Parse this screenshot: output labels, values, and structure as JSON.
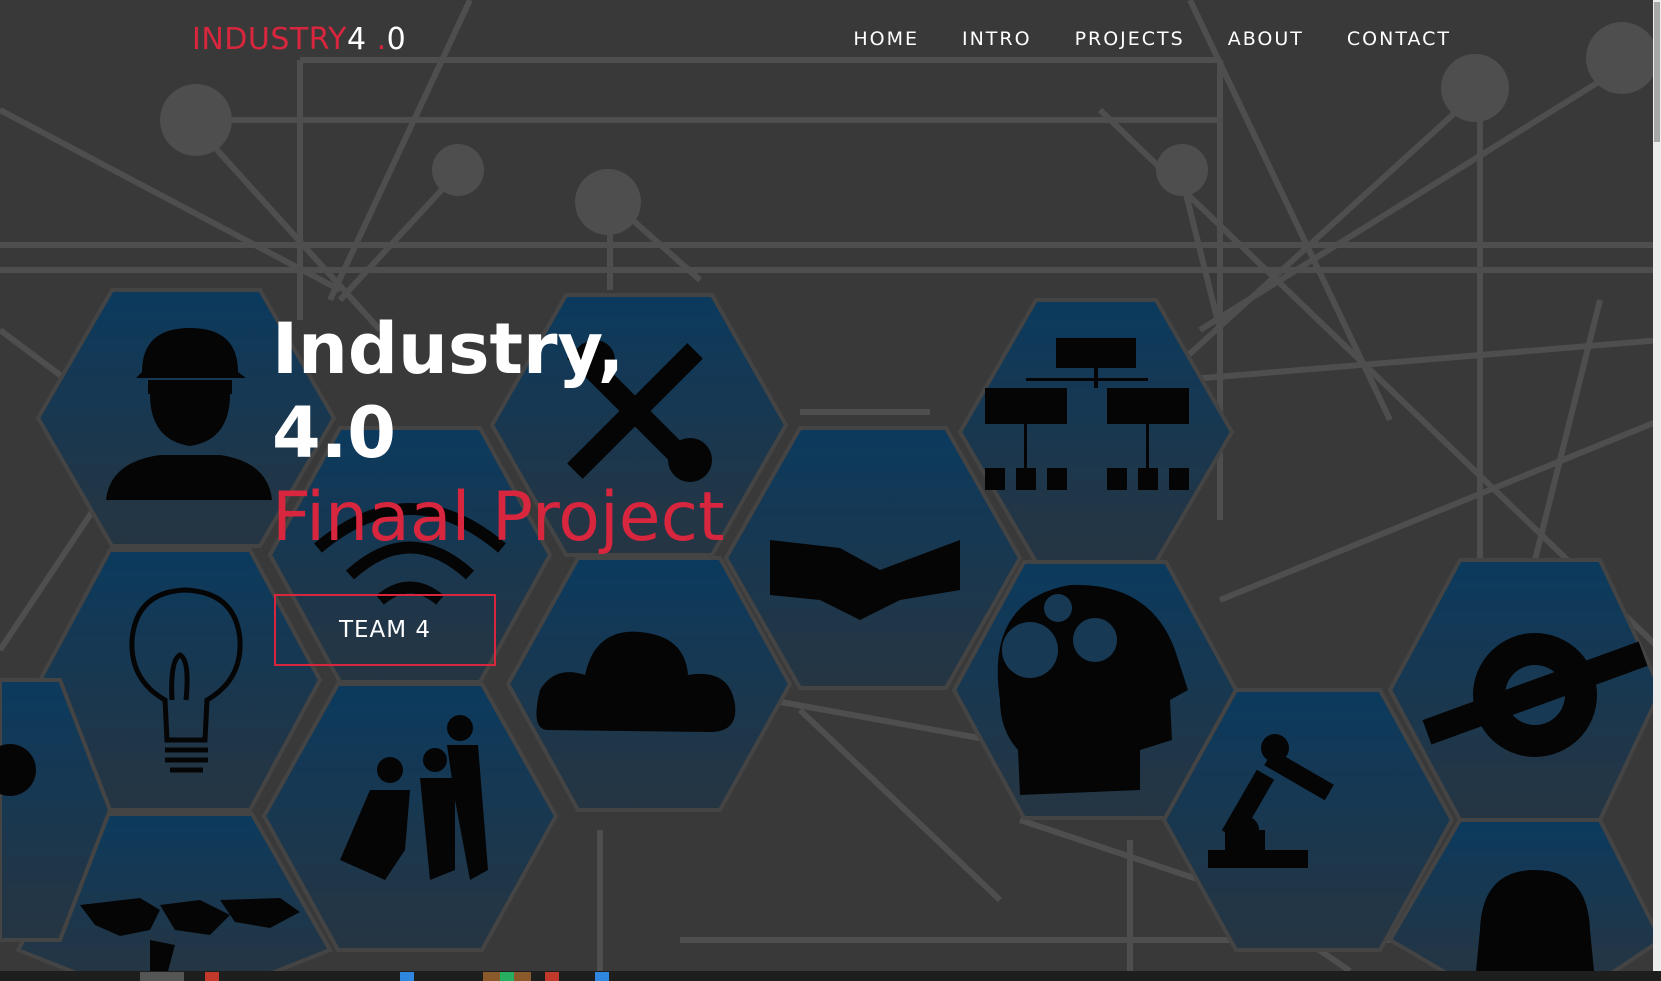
{
  "logo": {
    "part1": "INDUSTRY",
    "part2": "4",
    "dot": " .",
    "part3": "0"
  },
  "nav": {
    "items": [
      {
        "label": "HOME"
      },
      {
        "label": "INTRO"
      },
      {
        "label": "PROJECTS"
      },
      {
        "label": "ABOUT"
      },
      {
        "label": "CONTACT"
      }
    ]
  },
  "hero": {
    "line1": "Industry,",
    "line2": "4.0",
    "line3": "Finaal Project",
    "button_label": "TEAM 4"
  },
  "colors": {
    "accent": "#d7263d",
    "background": "#3d3d3d",
    "hexagon": "#0b3a5c",
    "text": "#ffffff"
  },
  "background_icons": [
    "worker-helmet-icon",
    "wrench-screwdriver-icon",
    "handshake-icon",
    "org-chart-icon",
    "wifi-icon",
    "lightbulb-icon",
    "cloud-icon",
    "brain-gears-icon",
    "team-people-icon",
    "robot-arm-icon",
    "service-gear-icon",
    "world-map-icon",
    "robot-icon"
  ]
}
